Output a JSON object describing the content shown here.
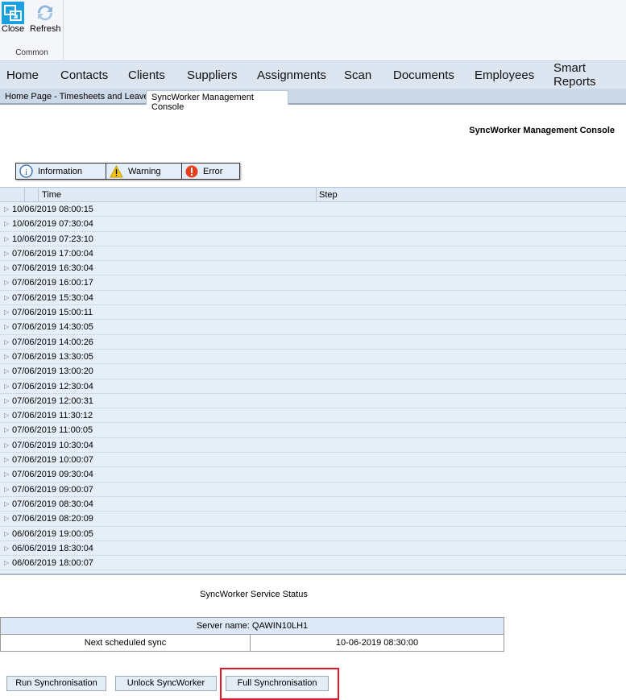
{
  "ribbon": {
    "close": "Close",
    "refresh": "Refresh",
    "group": "Common"
  },
  "nav": [
    "Home",
    "Contacts",
    "Clients",
    "Suppliers",
    "Assignments",
    "Scan",
    "Documents",
    "Employees",
    "Smart Reports"
  ],
  "tabs": [
    "Home Page - Timesheets and Leave",
    "SyncWorker Management Console"
  ],
  "console_title": "SyncWorker Management Console",
  "filters": {
    "information": "Information",
    "warning": "Warning",
    "error": "Error"
  },
  "grid": {
    "headers": {
      "time": "Time",
      "step": "Step"
    },
    "rows": [
      "10/06/2019 08:00:15",
      "10/06/2019 07:30:04",
      "10/06/2019 07:23:10",
      "07/06/2019 17:00:04",
      "07/06/2019 16:30:04",
      "07/06/2019 16:00:17",
      "07/06/2019 15:30:04",
      "07/06/2019 15:00:11",
      "07/06/2019 14:30:05",
      "07/06/2019 14:00:26",
      "07/06/2019 13:30:05",
      "07/06/2019 13:00:20",
      "07/06/2019 12:30:04",
      "07/06/2019 12:00:31",
      "07/06/2019 11:30:12",
      "07/06/2019 11:00:05",
      "07/06/2019 10:30:04",
      "07/06/2019 10:00:07",
      "07/06/2019 09:30:04",
      "07/06/2019 09:00:07",
      "07/06/2019 08:30:04",
      "07/06/2019 08:20:09",
      "06/06/2019 19:00:05",
      "06/06/2019 18:30:04",
      "06/06/2019 18:00:07"
    ]
  },
  "status": {
    "title": "SyncWorker Service Status",
    "server": "Server name: QAWIN10LH1",
    "next_label": "Next scheduled sync",
    "next_value": "10-06-2019 08:30:00"
  },
  "buttons": {
    "run": "Run Synchronisation",
    "unlock": "Unlock SyncWorker",
    "full": "Full Synchronisation"
  }
}
